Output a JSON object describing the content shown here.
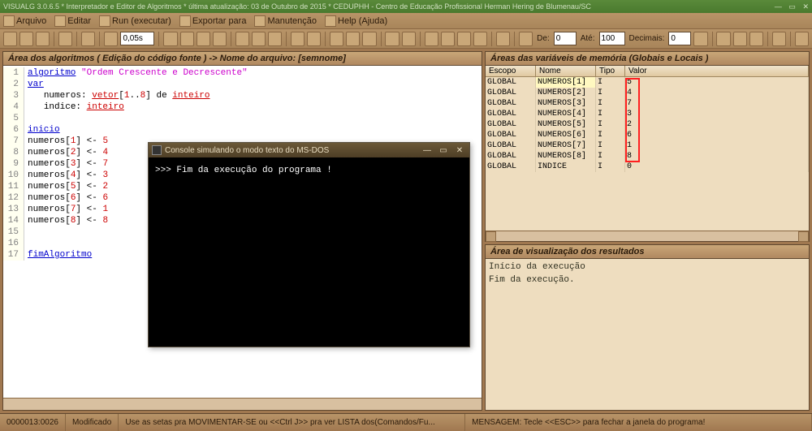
{
  "title": "VISUALG 3.0.6.5 * Interpretador e Editor de Algoritmos * última atualização: 03 de Outubro de 2015 * CEDUPHH - Centro de Educação Profissional Herman Hering de Blumenau/SC",
  "menubar": [
    {
      "label": "Arquivo"
    },
    {
      "label": "Editar"
    },
    {
      "label": "Run (executar)"
    },
    {
      "label": "Exportar para"
    },
    {
      "label": "Manutenção"
    },
    {
      "label": "Help (Ajuda)"
    }
  ],
  "toolbar": {
    "delay": "0,05s",
    "de_label": "De:",
    "de_val": "0",
    "ate_label": "Até:",
    "ate_val": "100",
    "dec_label": "Decimais:",
    "dec_val": "0"
  },
  "left_header_prefix": "Área dos algoritmos ( Edição do código fonte ) -> Nome do arquivo: ",
  "left_header_file": "[semnome]",
  "code_lines": [
    {
      "n": 1,
      "tokens": [
        [
          "sp",
          ""
        ],
        [
          "kw",
          "algoritmo"
        ],
        [
          "pl",
          " "
        ],
        [
          "str",
          "\"Ordem Crescente e Decrescente\""
        ]
      ]
    },
    {
      "n": 2,
      "tokens": [
        [
          "sp",
          ""
        ],
        [
          "kw",
          "var"
        ]
      ]
    },
    {
      "n": 3,
      "tokens": [
        [
          "sp",
          "   "
        ],
        [
          "pl",
          "numeros: "
        ],
        [
          "ty",
          "vetor"
        ],
        [
          "pl",
          "["
        ],
        [
          "idx",
          "1"
        ],
        [
          "pl",
          ".."
        ],
        [
          "idx",
          "8"
        ],
        [
          "pl",
          "] de "
        ],
        [
          "ty",
          "inteiro"
        ]
      ]
    },
    {
      "n": 4,
      "tokens": [
        [
          "sp",
          "   "
        ],
        [
          "pl",
          "indice: "
        ],
        [
          "ty",
          "inteiro"
        ]
      ]
    },
    {
      "n": 5,
      "tokens": []
    },
    {
      "n": 6,
      "tokens": [
        [
          "sp",
          ""
        ],
        [
          "kw",
          "inicio"
        ]
      ]
    },
    {
      "n": 7,
      "tokens": [
        [
          "sp",
          ""
        ],
        [
          "pl",
          "numeros["
        ],
        [
          "idx",
          "1"
        ],
        [
          "pl",
          "] <- "
        ],
        [
          "num",
          "5"
        ]
      ]
    },
    {
      "n": 8,
      "tokens": [
        [
          "sp",
          ""
        ],
        [
          "pl",
          "numeros["
        ],
        [
          "idx",
          "2"
        ],
        [
          "pl",
          "] <- "
        ],
        [
          "num",
          "4"
        ]
      ]
    },
    {
      "n": 9,
      "tokens": [
        [
          "sp",
          ""
        ],
        [
          "pl",
          "numeros["
        ],
        [
          "idx",
          "3"
        ],
        [
          "pl",
          "] <- "
        ],
        [
          "num",
          "7"
        ]
      ]
    },
    {
      "n": 10,
      "tokens": [
        [
          "sp",
          ""
        ],
        [
          "pl",
          "numeros["
        ],
        [
          "idx",
          "4"
        ],
        [
          "pl",
          "] <- "
        ],
        [
          "num",
          "3"
        ]
      ]
    },
    {
      "n": 11,
      "tokens": [
        [
          "sp",
          ""
        ],
        [
          "pl",
          "numeros["
        ],
        [
          "idx",
          "5"
        ],
        [
          "pl",
          "] <- "
        ],
        [
          "num",
          "2"
        ]
      ]
    },
    {
      "n": 12,
      "tokens": [
        [
          "sp",
          ""
        ],
        [
          "pl",
          "numeros["
        ],
        [
          "idx",
          "6"
        ],
        [
          "pl",
          "] <- "
        ],
        [
          "num",
          "6"
        ]
      ]
    },
    {
      "n": 13,
      "tokens": [
        [
          "sp",
          ""
        ],
        [
          "pl",
          "numeros["
        ],
        [
          "idx",
          "7"
        ],
        [
          "pl",
          "] <- "
        ],
        [
          "num",
          "1"
        ]
      ]
    },
    {
      "n": 14,
      "tokens": [
        [
          "sp",
          ""
        ],
        [
          "pl",
          "numeros["
        ],
        [
          "idx",
          "8"
        ],
        [
          "pl",
          "] <- "
        ],
        [
          "num",
          "8"
        ]
      ]
    },
    {
      "n": 15,
      "tokens": []
    },
    {
      "n": 16,
      "tokens": []
    },
    {
      "n": 17,
      "tokens": [
        [
          "sp",
          ""
        ],
        [
          "kw",
          "fimAlgoritmo"
        ]
      ]
    }
  ],
  "vars_header": "Áreas das variáveis de memória (Globais e Locais )",
  "vars_cols": {
    "escopo": "Escopo",
    "nome": "Nome",
    "tipo": "Tipo",
    "valor": "Valor"
  },
  "vars_rows": [
    {
      "escopo": "GLOBAL",
      "nome": "NUMEROS[1]",
      "tipo": "I",
      "valor": "5",
      "hilite": true
    },
    {
      "escopo": "GLOBAL",
      "nome": "NUMEROS[2]",
      "tipo": "I",
      "valor": "4"
    },
    {
      "escopo": "GLOBAL",
      "nome": "NUMEROS[3]",
      "tipo": "I",
      "valor": "7"
    },
    {
      "escopo": "GLOBAL",
      "nome": "NUMEROS[4]",
      "tipo": "I",
      "valor": "3"
    },
    {
      "escopo": "GLOBAL",
      "nome": "NUMEROS[5]",
      "tipo": "I",
      "valor": "2"
    },
    {
      "escopo": "GLOBAL",
      "nome": "NUMEROS[6]",
      "tipo": "I",
      "valor": "6"
    },
    {
      "escopo": "GLOBAL",
      "nome": "NUMEROS[7]",
      "tipo": "I",
      "valor": "1"
    },
    {
      "escopo": "GLOBAL",
      "nome": "NUMEROS[8]",
      "tipo": "I",
      "valor": "8"
    },
    {
      "escopo": "GLOBAL",
      "nome": "INDICE",
      "tipo": "I",
      "valor": "0"
    }
  ],
  "results_header": "Área de visualização dos resultados",
  "results_lines": [
    "Início da execução",
    "Fim da execução."
  ],
  "console_title": "Console simulando o modo texto do MS-DOS",
  "console_text": ">>> Fim da execução do programa !",
  "statusbar": {
    "pos": "0000013:0026",
    "mod": "Modificado",
    "help": "Use as setas pra MOVIMENTAR-SE ou <<Ctrl J>> pra ver LISTA dos(Comandos/Fu...",
    "msg": "MENSAGEM: Tecle <<ESC>> para fechar a janela do programa!"
  }
}
